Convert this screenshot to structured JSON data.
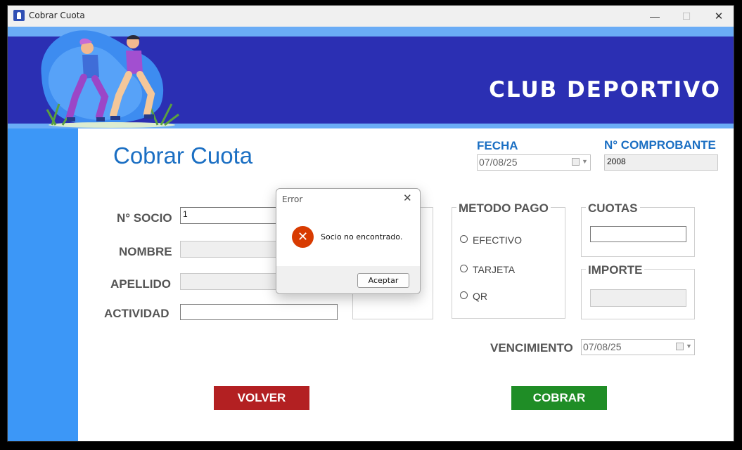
{
  "window": {
    "title": "Cobrar Cuota"
  },
  "banner": {
    "brand": "CLUB DEPORTIVO"
  },
  "page": {
    "title": "Cobrar Cuota"
  },
  "fecha": {
    "label": "FECHA",
    "value": "07/08/25"
  },
  "comprobante": {
    "label": "N° COMPROBANTE",
    "value": "2008"
  },
  "form": {
    "socio_label": "N° SOCIO",
    "socio_value": "1",
    "nombre_label": "NOMBRE",
    "apellido_label": "APELLIDO",
    "actividad_label": "ACTIVIDAD"
  },
  "metodo_pago": {
    "title": "METODO PAGO",
    "options": [
      "EFECTIVO",
      "TARJETA",
      "QR"
    ]
  },
  "cuotas": {
    "title": "CUOTAS"
  },
  "importe": {
    "title": "IMPORTE"
  },
  "vencimiento": {
    "label": "VENCIMIENTO",
    "value": "07/08/25"
  },
  "buttons": {
    "volver": "VOLVER",
    "cobrar": "COBRAR"
  },
  "dialog": {
    "title": "Error",
    "message": "Socio no encontrado.",
    "button": "Aceptar"
  },
  "colors": {
    "banner_band": "#2b2fb3",
    "sidebar": "#3c97f7",
    "volver": "#b32022",
    "cobrar": "#1f8d26",
    "error_icon": "#d83b01"
  }
}
